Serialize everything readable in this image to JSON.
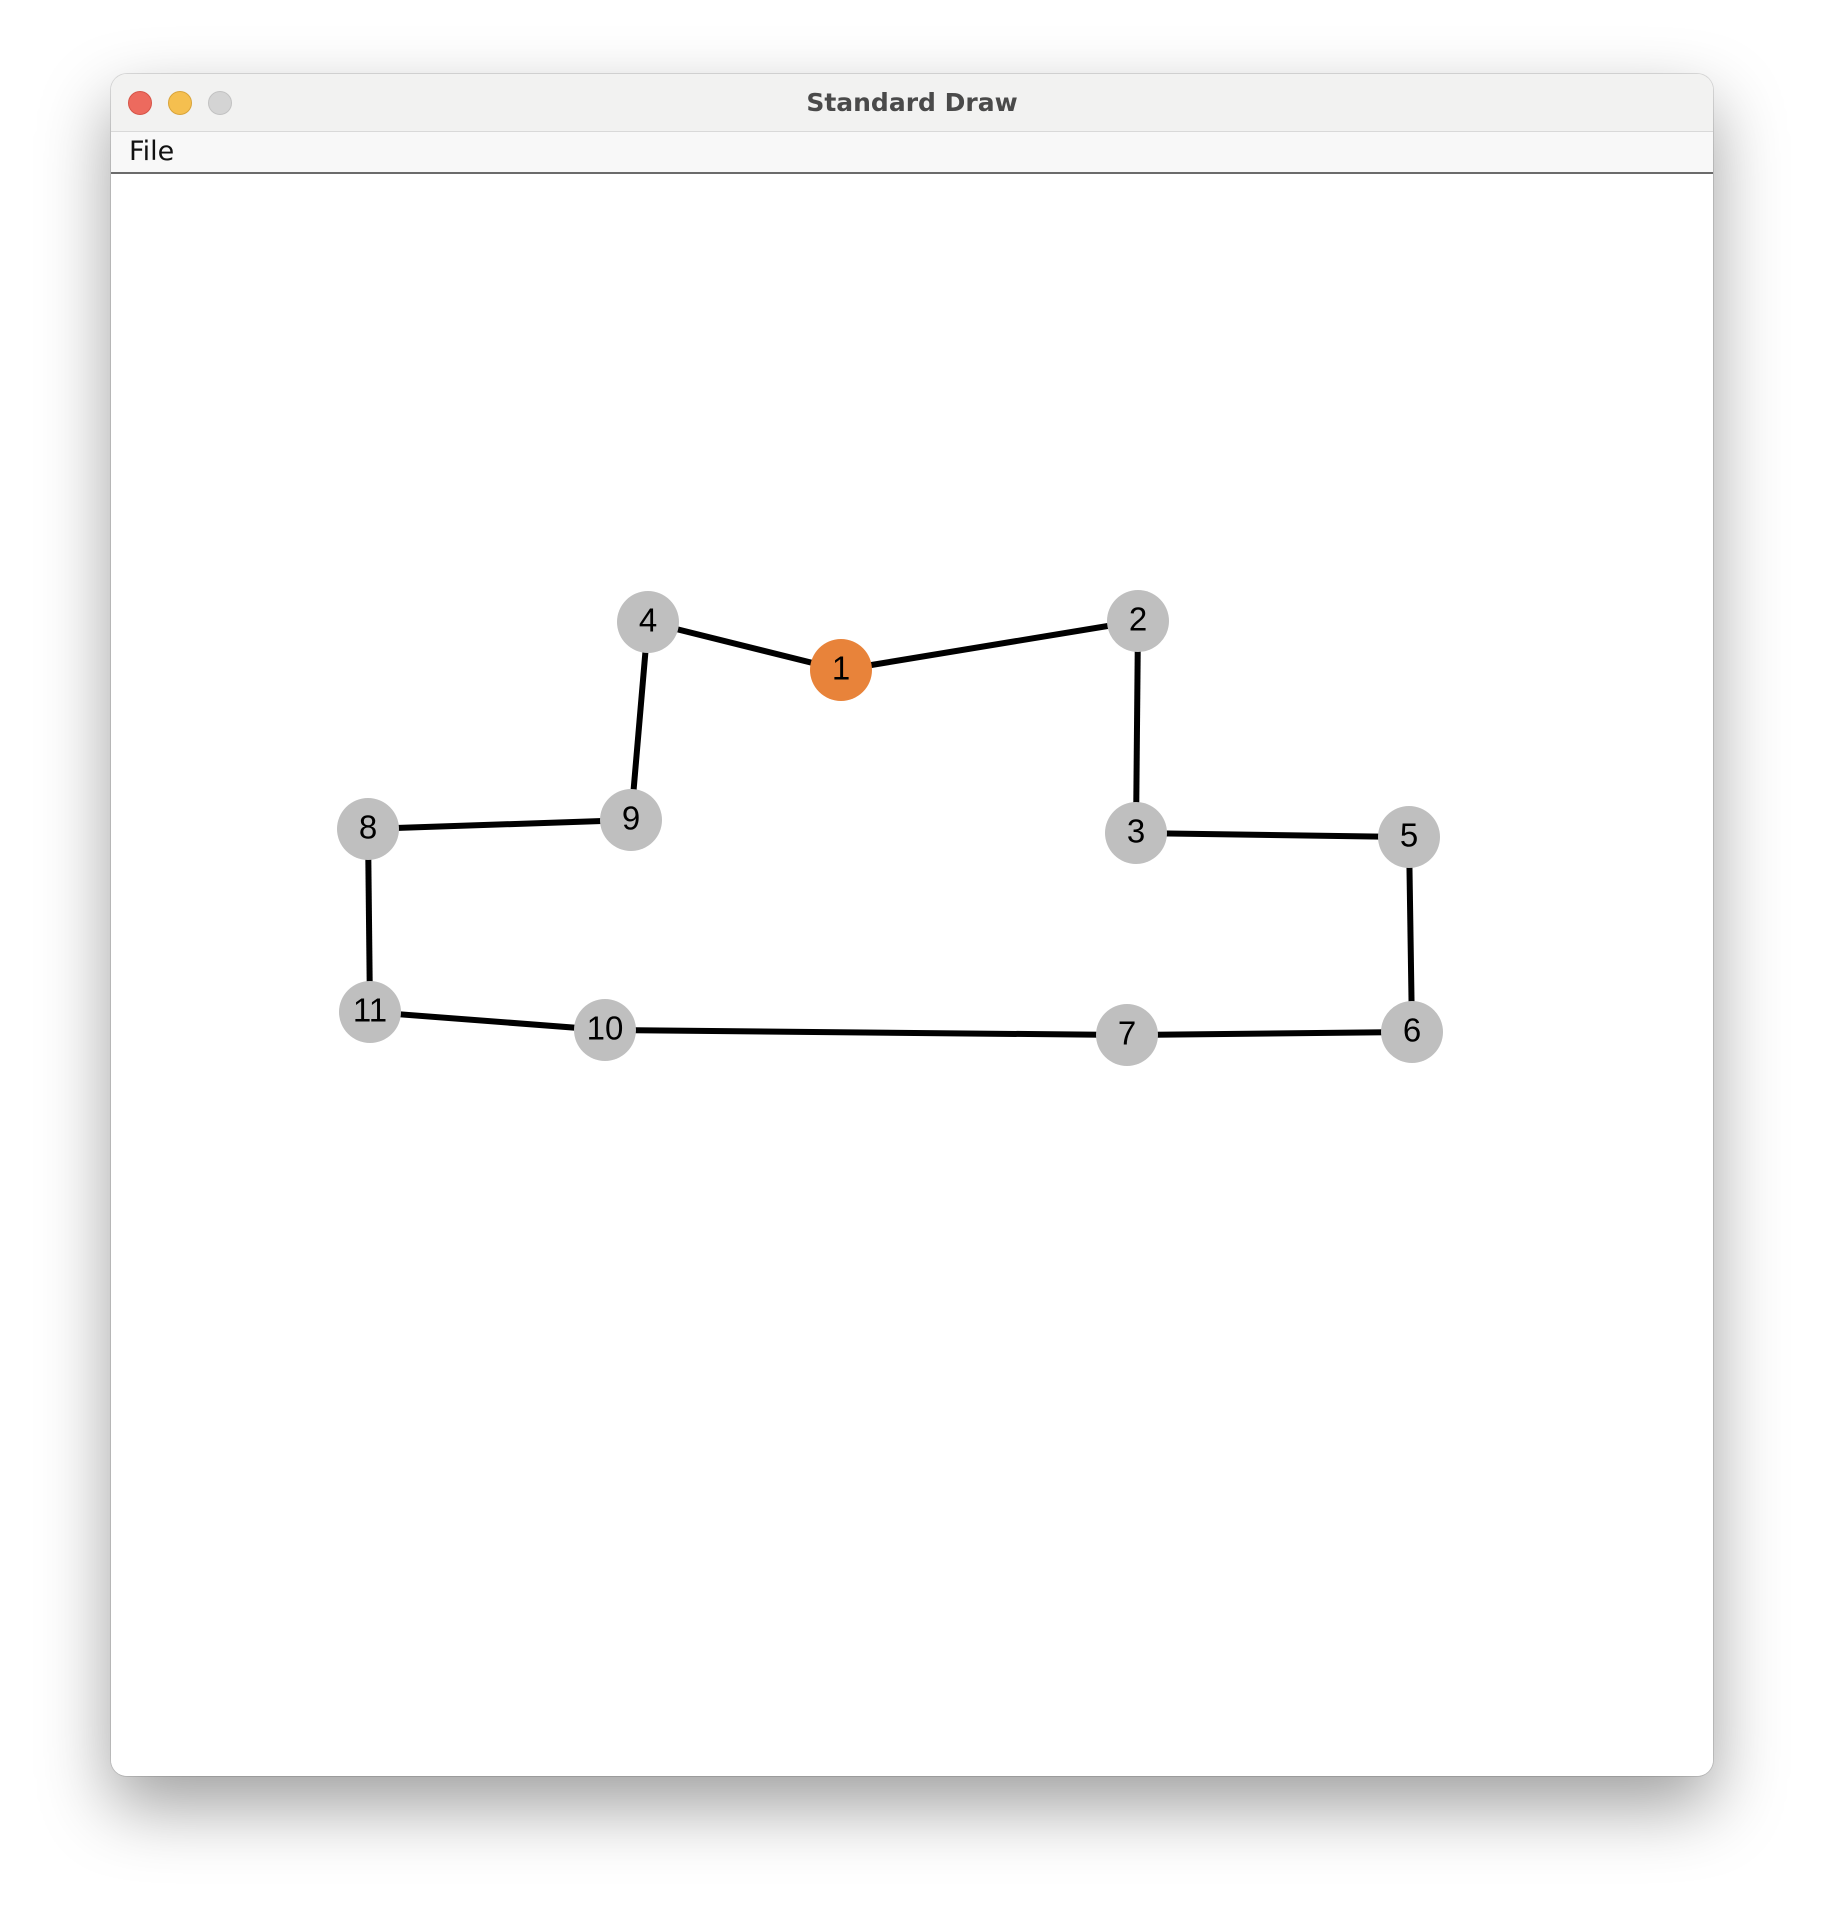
{
  "window": {
    "title": "Standard Draw"
  },
  "menubar": {
    "file_label": "File"
  },
  "graph": {
    "highlight_color": "#E8833A",
    "node_color": "#BFBFBF",
    "edge_color": "#000000",
    "nodes": [
      {
        "id": "1",
        "highlighted": true
      },
      {
        "id": "2",
        "highlighted": false
      },
      {
        "id": "3",
        "highlighted": false
      },
      {
        "id": "4",
        "highlighted": false
      },
      {
        "id": "5",
        "highlighted": false
      },
      {
        "id": "6",
        "highlighted": false
      },
      {
        "id": "7",
        "highlighted": false
      },
      {
        "id": "8",
        "highlighted": false
      },
      {
        "id": "9",
        "highlighted": false
      },
      {
        "id": "10",
        "highlighted": false
      },
      {
        "id": "11",
        "highlighted": false
      }
    ],
    "edges": [
      [
        "4",
        "1"
      ],
      [
        "1",
        "2"
      ],
      [
        "2",
        "3"
      ],
      [
        "3",
        "5"
      ],
      [
        "5",
        "6"
      ],
      [
        "6",
        "7"
      ],
      [
        "7",
        "10"
      ],
      [
        "10",
        "11"
      ],
      [
        "11",
        "8"
      ],
      [
        "8",
        "9"
      ],
      [
        "9",
        "4"
      ]
    ]
  }
}
